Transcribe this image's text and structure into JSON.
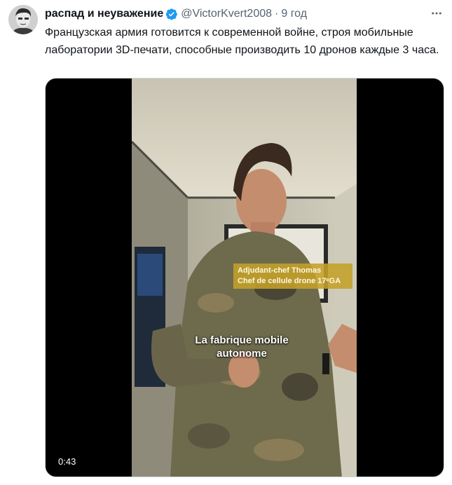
{
  "tweet": {
    "display_name": "распад и неуважение",
    "handle": "@VictorKvert2008",
    "separator": "·",
    "time": "9 год",
    "text": "Французская армия готовится к современной войне, строя мобильные лаборатории 3D-печати, способные производить 10 дронов каждые 3 часа."
  },
  "video": {
    "caption_line1": "Adjudant-chef Thomas",
    "caption_line2": "Chef de cellule drone 17ᵉGA",
    "overlay_line1": "La fabrique mobile",
    "overlay_line2": "autonome",
    "duration": "0:43"
  },
  "icons": {
    "verified": "verified-badge-icon",
    "more": "more-options-icon"
  },
  "colors": {
    "verified_blue": "#1d9bf0",
    "secondary_text": "#536471"
  }
}
